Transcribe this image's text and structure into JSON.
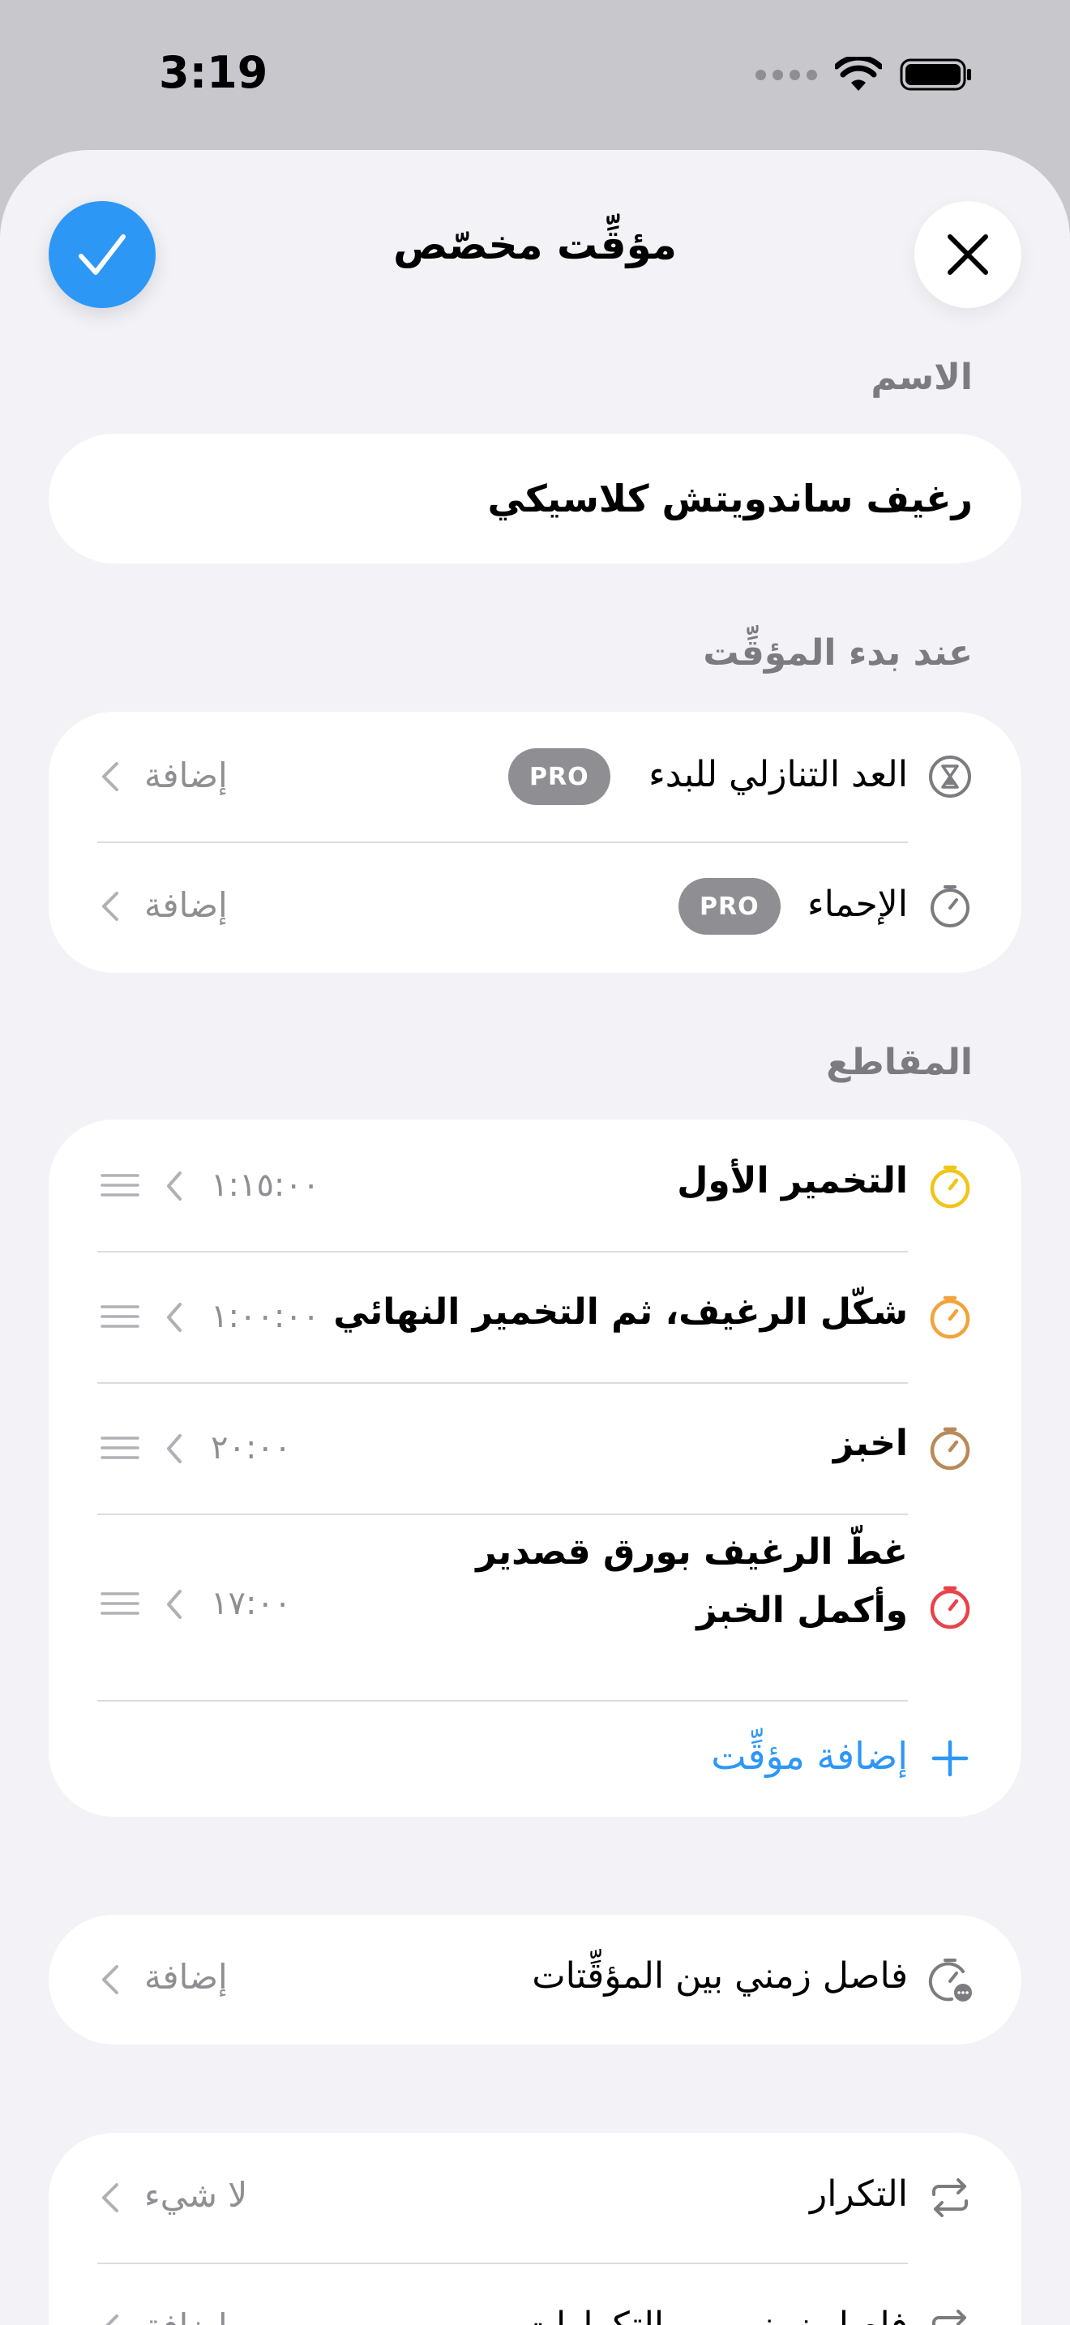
{
  "status_bar": {
    "time": "3:19"
  },
  "header": {
    "title": "مؤقِّت مخصّص"
  },
  "name_section": {
    "label": "الاسم",
    "value": "رغيف ساندويتش كلاسيكي"
  },
  "start_section": {
    "label": "عند بدء المؤقِّت",
    "items": [
      {
        "label": "العد التنازلي للبدء",
        "badge": "PRO",
        "value": "إضافة",
        "icon": "hourglass-icon"
      },
      {
        "label": "الإحماء",
        "badge": "PRO",
        "value": "إضافة",
        "icon": "stopwatch-icon"
      }
    ]
  },
  "segments_section": {
    "label": "المقاطع",
    "items": [
      {
        "label": "التخمير الأول",
        "time": "١:١٥:٠٠",
        "color": "#f2c417"
      },
      {
        "label": "شكّل الرغيف، ثم التخمير النهائي",
        "time": "١:٠٠:٠٠",
        "color": "#f2a33a"
      },
      {
        "label": "اخبز",
        "time": "٢٠:٠٠",
        "color": "#b88a5a"
      },
      {
        "label_line1": "غطّ الرغيف بورق قصدير",
        "label_line2": "وأكمل الخبز",
        "time": "١٧:٠٠",
        "color": "#e8434a"
      }
    ],
    "add_label": "إضافة مؤقِّت"
  },
  "interval_section": {
    "label": "فاصل زمني بين المؤقِّتات",
    "value": "إضافة"
  },
  "repeat_section": {
    "items": [
      {
        "label": "التكرار",
        "value": "لا شيء"
      },
      {
        "label": "فاصل زمني بين التكرارات",
        "value": "إضافة"
      }
    ]
  },
  "colors": {
    "accent": "#2d97f5",
    "background": "#f2f2f7",
    "secondary_text": "#8e8e93"
  }
}
